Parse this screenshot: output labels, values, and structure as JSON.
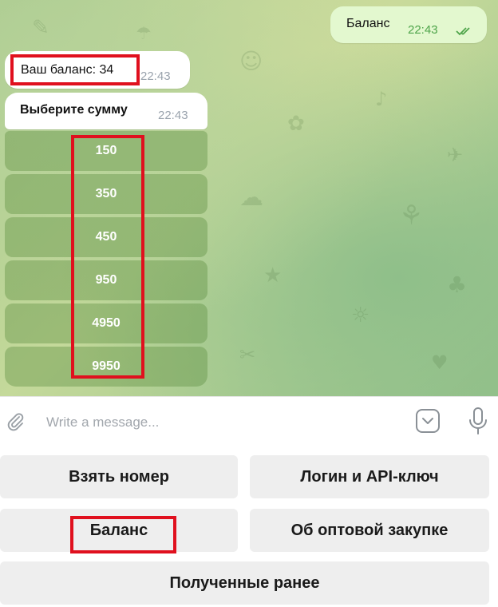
{
  "chat": {
    "outgoing": {
      "text": "Баланс",
      "time": "22:43"
    },
    "balance_message": {
      "text": "Ваш баланс: 34",
      "time": "22:43"
    },
    "choose_message": {
      "text": "Выберите сумму",
      "time": "22:43"
    },
    "amounts": [
      "150",
      "350",
      "450",
      "950",
      "4950",
      "9950"
    ]
  },
  "composer": {
    "placeholder": "Write a message..."
  },
  "reply_keyboard": {
    "take_number": "Взять номер",
    "login_api": "Логин и API-ключ",
    "balance": "Баланс",
    "wholesale": "Об оптовой закупке",
    "received": "Полученные ранее"
  },
  "icons": {
    "attach": "paperclip-icon",
    "sticker": "sticker-icon",
    "mic": "microphone-icon",
    "read": "double-check-icon"
  },
  "colors": {
    "outgoing_bubble": "#e3f8cf",
    "time_outgoing": "#4ea44a",
    "highlight": "#e0101e",
    "keyboard_button": "#eeeeee"
  }
}
